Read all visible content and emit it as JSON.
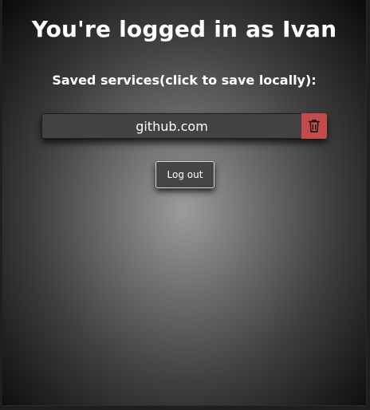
{
  "header": {
    "title": "You're logged in as Ivan",
    "subtitle": "Saved services(click to save locally):"
  },
  "services": [
    {
      "name": "github.com",
      "delete_icon": "trash-icon"
    }
  ],
  "actions": {
    "logout_label": "Log out"
  },
  "colors": {
    "delete_button": "#c44b4b",
    "service_bg": "#434343",
    "text": "#ffffff"
  }
}
